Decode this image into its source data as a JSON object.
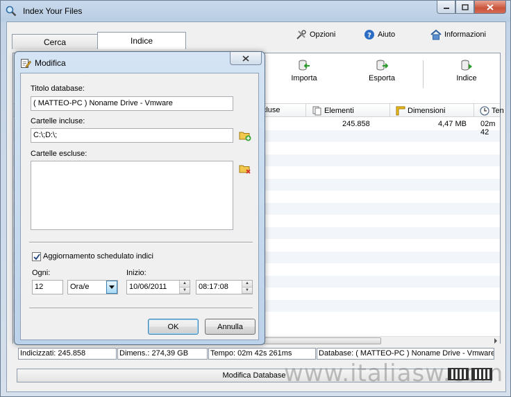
{
  "window": {
    "title": "Index Your Files"
  },
  "tabs": [
    {
      "label": "Cerca"
    },
    {
      "label": "Indice"
    }
  ],
  "top_links": {
    "options": "Opzioni",
    "help": "Aiuto",
    "info": "Informazioni"
  },
  "toolbar": {
    "import": "Importa",
    "export": "Esporta",
    "index": "Indice"
  },
  "grid": {
    "columns": {
      "excluded": "Escluse",
      "items": "Elementi",
      "size": "Dimensioni",
      "time": "Ten"
    },
    "row": {
      "items": "245.858",
      "size": "4,47 MB",
      "time": "02m 42"
    }
  },
  "status": {
    "indexed": "Indicizzati: 245.858",
    "size": "Dimens.: 274,39 GB",
    "time": "Tempo: 02m 42s 261ms",
    "database": "Database: ( MATTEO-PC ) Noname Drive - Vmware"
  },
  "bottom_bar": {
    "label": "Modifica Database"
  },
  "watermark": "www.italiasw.com",
  "dialog": {
    "title": "Modifica",
    "db_title_label": "Titolo database:",
    "db_title_value": "( MATTEO-PC ) Noname Drive - Vmware",
    "included_label": "Cartelle incluse:",
    "included_value": "C:\\;D:\\;",
    "excluded_label": "Cartelle escluse:",
    "excluded_value": "",
    "scheduled_label": "Aggiornamento schedulato indici",
    "scheduled_checked": true,
    "every_label": "Ogni:",
    "every_value": "12",
    "unit_value": "Ora/e",
    "start_label": "Inizio:",
    "start_date": "10/06/2011",
    "start_time": "08:17:08",
    "ok": "OK",
    "cancel": "Annulla"
  }
}
